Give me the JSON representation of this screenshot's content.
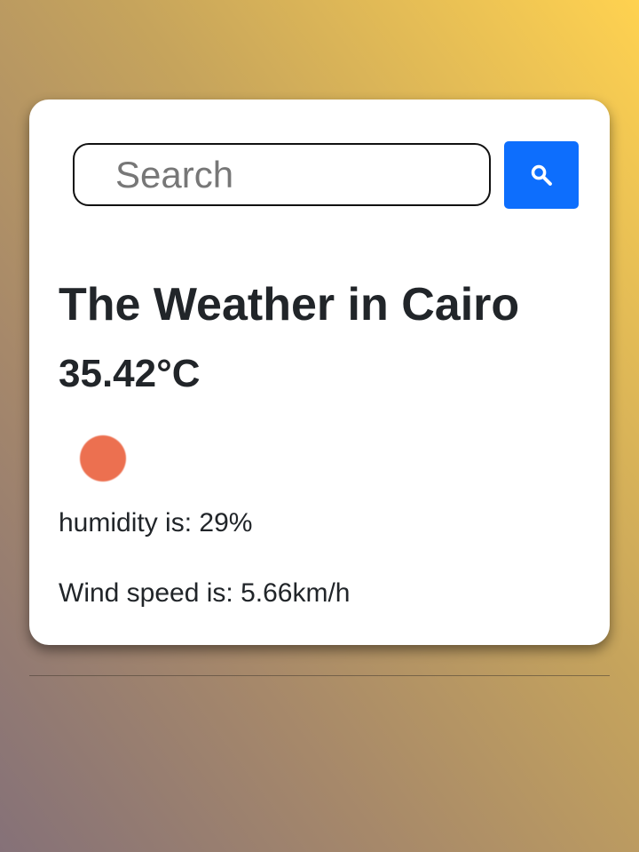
{
  "search": {
    "placeholder": "Search",
    "value": "",
    "button_icon": "search-icon"
  },
  "weather": {
    "title": "The Weather in Cairo",
    "temperature": "35.42°C",
    "icon": "sun-icon",
    "humidity": "humidity is: 29%",
    "wind": "Wind speed is: 5.66km/h"
  },
  "colors": {
    "accent": "#0d6efd",
    "icon": "#ec7050",
    "text": "#212529",
    "gradient_start": "#857178",
    "gradient_end": "#ffd250"
  }
}
